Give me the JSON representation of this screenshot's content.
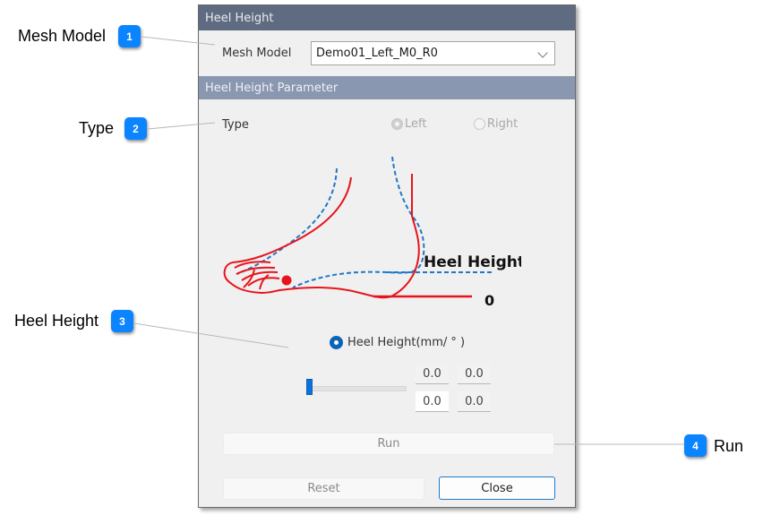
{
  "callouts": [
    {
      "number": "1",
      "label": "Mesh Model"
    },
    {
      "number": "2",
      "label": "Type"
    },
    {
      "number": "3",
      "label": "Heel Height"
    },
    {
      "number": "4",
      "label": "Run"
    }
  ],
  "dialog": {
    "title": "Heel Height",
    "mesh_model": {
      "label": "Mesh Model",
      "selected": "Demo01_Left_M0_R0"
    },
    "section_title": "Heel Height Parameter",
    "type": {
      "label": "Type",
      "options": [
        {
          "label": "Left",
          "checked": true,
          "enabled": false
        },
        {
          "label": "Right",
          "checked": false,
          "enabled": false
        }
      ]
    },
    "illustration": {
      "heel_height_label": "Heel Height",
      "zero_label": "0",
      "colors": {
        "foot_flat": "#e8141c",
        "foot_raised": "#1f78c8"
      }
    },
    "heel_height": {
      "radio_label": "Heel Height(mm/ ° )",
      "checked": true,
      "slider_value_fraction": 0.0,
      "values": [
        "0.0",
        "0.0",
        "0.0",
        "0.0"
      ]
    },
    "buttons": {
      "run": "Run",
      "reset": "Reset",
      "close": "Close"
    }
  },
  "colors": {
    "title_bar": "#5f6b80",
    "section_bar": "#8a97b0",
    "badge": "#0a84ff",
    "accent": "#0a64b8"
  }
}
